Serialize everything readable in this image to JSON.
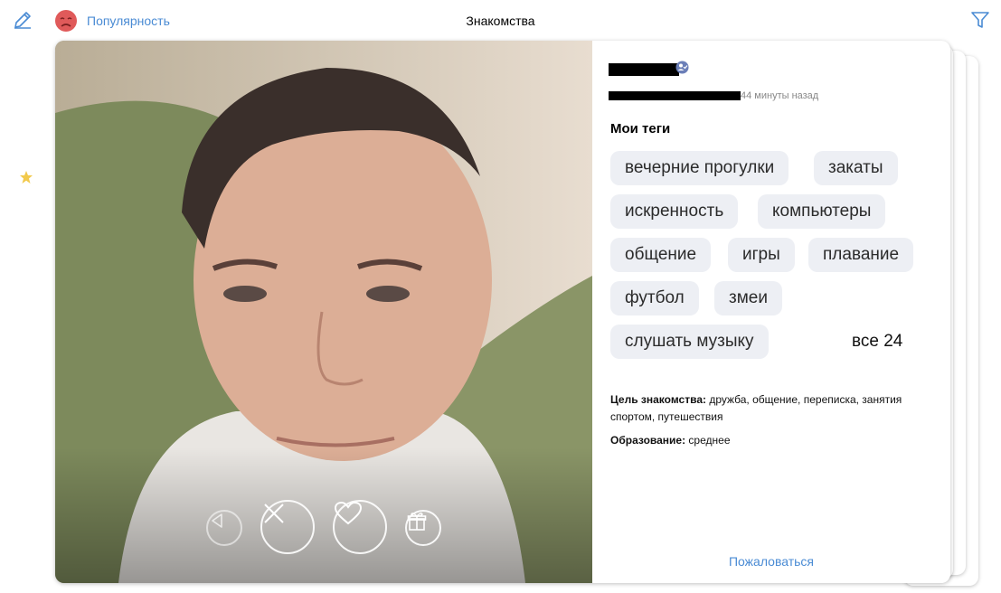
{
  "header": {
    "edit_icon": "pencil-icon",
    "popularity_label": "Популярность",
    "popularity_icon": "sad-face-icon",
    "title": "Знакомства",
    "filter_icon": "filter-icon"
  },
  "sidebar": {
    "favorite_icon": "star-icon"
  },
  "profile": {
    "last_seen": "44 минуты назад",
    "verified_icon": "verified-user-icon",
    "tags_title": "Мои теги",
    "tags": [
      "вечерние прогулки",
      "закаты",
      "искренность",
      "компьютеры",
      "общение",
      "игры",
      "плавание",
      "футбол",
      "змеи",
      "слушать музыку"
    ],
    "tags_all": "все 24",
    "goal_label": "Цель знакомства:",
    "goal_value": " дружба, общение, переписка, занятия спортом, путешествия",
    "education_label": "Образование:",
    "education_value": " среднее",
    "report_label": "Пожаловаться"
  },
  "actions": {
    "back_icon": "triangle-left-icon",
    "dislike_icon": "cross-icon",
    "like_icon": "heart-icon",
    "gift_icon": "gift-icon"
  },
  "colors": {
    "accent": "#4a8bd4",
    "tag_bg": "#edeff4",
    "popularity_face": "#e05a5a"
  }
}
